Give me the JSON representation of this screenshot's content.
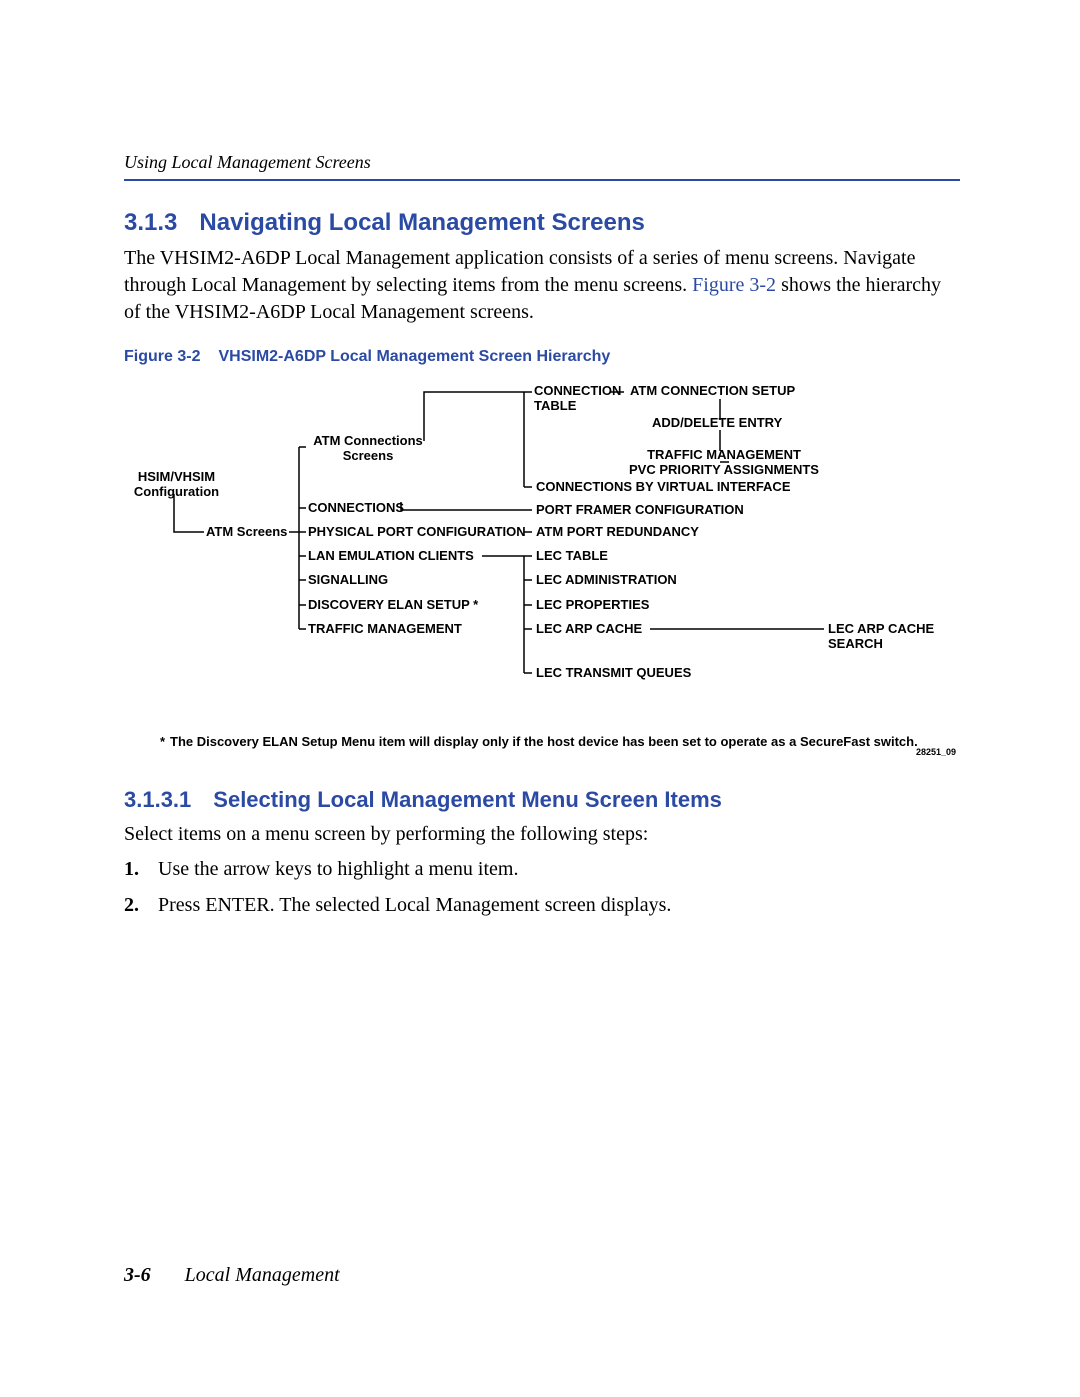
{
  "header": {
    "running": "Using Local Management Screens"
  },
  "section": {
    "num": "3.1.3",
    "title": "Navigating Local Management Screens",
    "para_a": "The VHSIM2-A6DP Local Management application consists of a series of menu screens. Navigate through Local Management by selecting items from the menu screens. ",
    "link": "Figure 3-2",
    "para_b": " shows the hierarchy of the VHSIM2-A6DP Local Management screens."
  },
  "figure": {
    "num": "Figure 3-2",
    "title": "VHSIM2-A6DP Local Management Screen Hierarchy",
    "image_id": "28251_09",
    "note": "The Discovery ELAN Setup Menu item will display only if the host device has been set to operate as a SecureFast switch.",
    "nodes": {
      "root": "HSIM/VHSIM\nConfiguration",
      "atm_screens": "ATM Screens",
      "atm_conn_screens": "ATM Connections\nScreens",
      "connections": "CONNECTIONS",
      "phys_port": "PHYSICAL PORT CONFIGURATION",
      "lan_emu": "LAN EMULATION CLIENTS",
      "signalling": "SIGNALLING",
      "discovery": "DISCOVERY ELAN SETUP *",
      "traffic_mgmt": "TRAFFIC MANAGEMENT",
      "conn_table": "CONNECTION\nTABLE",
      "atm_conn_setup": "ATM CONNECTION SETUP",
      "add_del": "ADD/DELETE ENTRY",
      "traffic_pvc": "TRAFFIC MANAGEMENT\nPVC PRIORITY ASSIGNMENTS",
      "conn_by_vi": "CONNECTIONS BY VIRTUAL INTERFACE",
      "port_framer": "PORT FRAMER CONFIGURATION",
      "atm_port_red": "ATM PORT REDUNDANCY",
      "lec_table": "LEC TABLE",
      "lec_admin": "LEC ADMINISTRATION",
      "lec_props": "LEC PROPERTIES",
      "lec_arp": "LEC ARP CACHE",
      "lec_arp_search": "LEC ARP CACHE\nSEARCH",
      "lec_tx": "LEC TRANSMIT QUEUES"
    }
  },
  "subsection": {
    "num": "3.1.3.1",
    "title": "Selecting Local Management Menu Screen Items",
    "intro": "Select items on a menu screen by performing the following steps:",
    "steps": [
      "Use the arrow keys to highlight a menu item.",
      "Press ENTER. The selected Local Management screen displays."
    ]
  },
  "footer": {
    "page": "3-6",
    "title": "Local Management"
  }
}
